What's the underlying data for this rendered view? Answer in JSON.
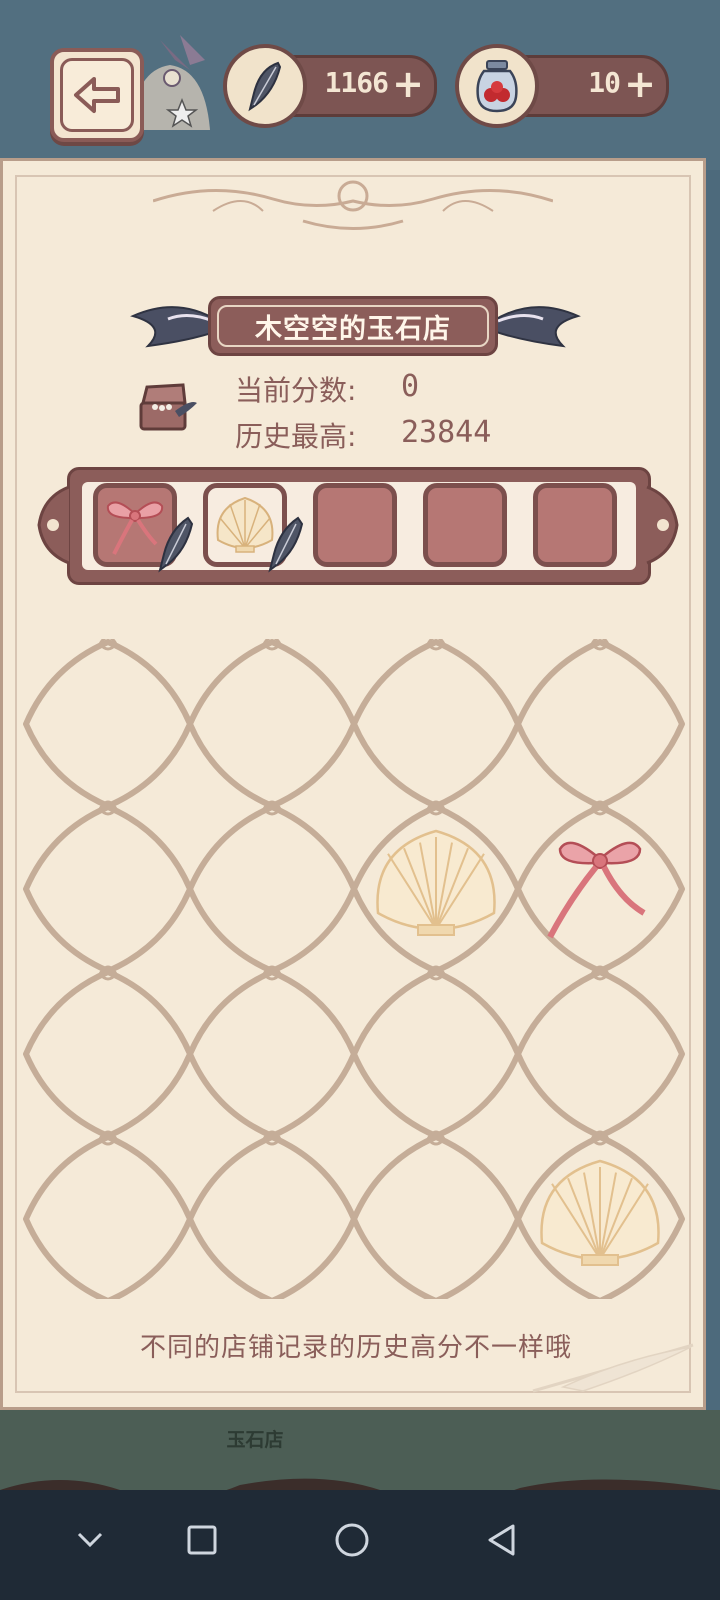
{
  "header": {
    "back_icon": "arrow-left-icon",
    "feather_count": "1166",
    "feather_plus": "+",
    "berry_count": "10",
    "berry_plus": "+"
  },
  "panel": {
    "shop_title": "木空空的玉石店",
    "current_score_label": "当前分数:",
    "current_score_value": "0",
    "high_score_label": "历史最高:",
    "high_score_value": "23844",
    "hint": "不同的店铺记录的历史高分不一样哦"
  },
  "slots": [
    {
      "item": "ribbon"
    },
    {
      "item": "shell"
    },
    {
      "item": ""
    },
    {
      "item": ""
    },
    {
      "item": ""
    }
  ],
  "grid": {
    "rows": 4,
    "cols": 4,
    "items": [
      {
        "row": 2,
        "col": 3,
        "item": "shell"
      },
      {
        "row": 2,
        "col": 4,
        "item": "ribbon"
      },
      {
        "row": 4,
        "col": 4,
        "item": "shell"
      }
    ]
  },
  "background": {
    "shop_sign": "玉石店"
  },
  "colors": {
    "panel_bg": "#f5ead8",
    "accent": "#8c5d5a",
    "slot_fill": "#b67774"
  }
}
